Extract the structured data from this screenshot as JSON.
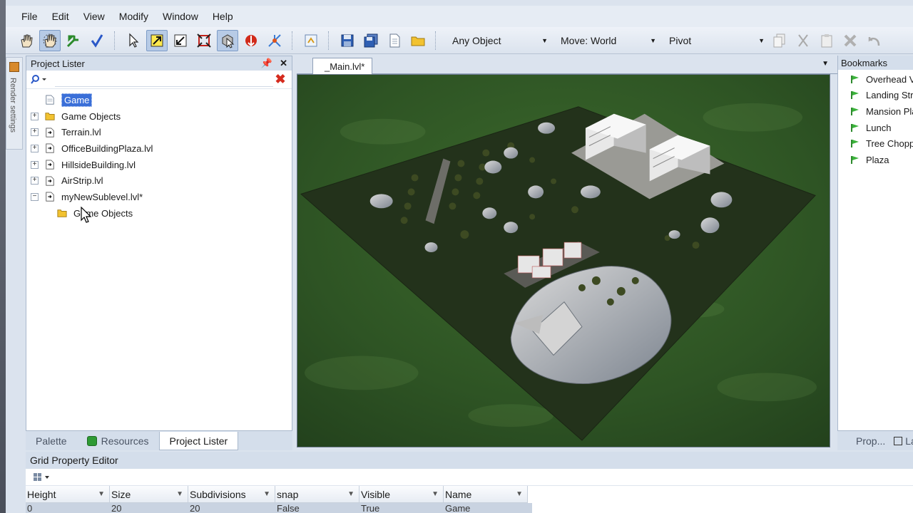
{
  "menu": [
    "File",
    "Edit",
    "View",
    "Modify",
    "Window",
    "Help"
  ],
  "toolbar": {
    "selection_filter": "Any Object",
    "move_mode": "Move: World",
    "pivot": "Pivot"
  },
  "render_settings_label": "Render settings",
  "project_lister": {
    "title": "Project Lister",
    "search_placeholder": "",
    "tree": [
      {
        "label": "Game",
        "selected": true,
        "expander": "none",
        "icon": "page-icon"
      },
      {
        "label": "Game Objects",
        "expander": "plus",
        "icon": "folder-icon"
      },
      {
        "label": "Terrain.lvl",
        "expander": "plus",
        "icon": "level-icon"
      },
      {
        "label": "OfficeBuildingPlaza.lvl",
        "expander": "plus",
        "icon": "level-icon"
      },
      {
        "label": "HillsideBuilding.lvl",
        "expander": "plus",
        "icon": "level-icon"
      },
      {
        "label": "AirStrip.lvl",
        "expander": "plus",
        "icon": "level-icon"
      },
      {
        "label": "myNewSublevel.lvl*",
        "expander": "minus",
        "icon": "level-icon"
      },
      {
        "label": "Game Objects",
        "expander": "none",
        "icon": "folder-icon",
        "child": true
      }
    ],
    "tabs": [
      "Palette",
      "Resources",
      "Project Lister"
    ],
    "active_tab": "Project Lister"
  },
  "document": {
    "tab_title": "_Main.lvl*"
  },
  "bookmarks": {
    "title": "Bookmarks",
    "items": [
      "Overhead View",
      "Landing Strip",
      "Mansion Plaza",
      "Lunch",
      "Tree Chopper",
      "Plaza"
    ],
    "tabs": [
      "Prop...",
      "La"
    ]
  },
  "grid_editor": {
    "title": "Grid Property Editor",
    "columns": [
      "Height",
      "Size",
      "Subdivisions",
      "snap",
      "Visible",
      "Name"
    ],
    "row": [
      "0",
      "20",
      "20",
      "False",
      "True",
      "Game"
    ]
  },
  "colors": {
    "accent": "#3a6fd8",
    "panel_header": "#d4deeb",
    "error_red": "#d52b1e",
    "grass_green": "#2e5a24"
  }
}
